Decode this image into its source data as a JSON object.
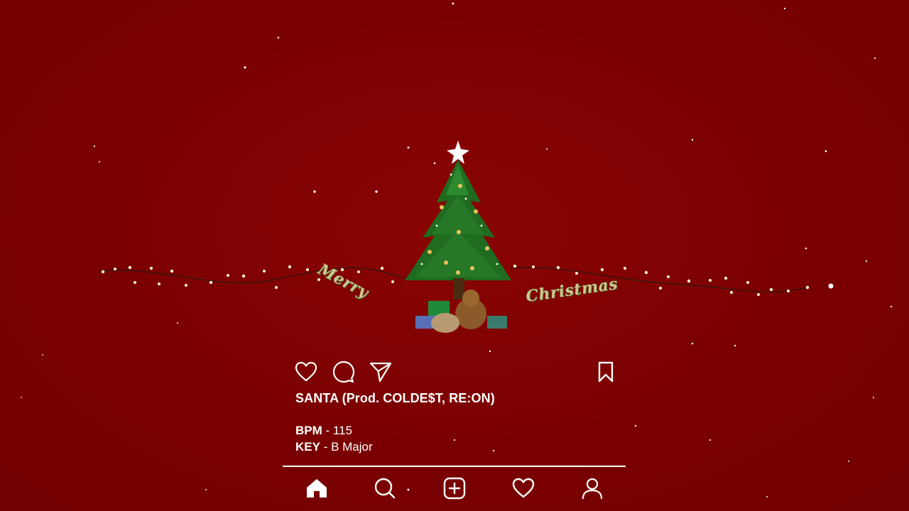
{
  "artwork": {
    "word_left": "Merry",
    "word_right": "Christmas",
    "colors": {
      "background": "#7a0000",
      "tree": "#1f6b1f",
      "star": "#ffffff",
      "text_gold": "#c9c78f"
    }
  },
  "post": {
    "actions": [
      {
        "icon": "heart-outline-icon"
      },
      {
        "icon": "comment-bubble-icon"
      },
      {
        "icon": "send-paper-plane-icon"
      },
      {
        "icon": "bookmark-icon"
      }
    ],
    "title": "SANTA (Prod. COLDE$T, RE:ON)",
    "bpm_label": "BPM",
    "bpm_value": " - 115",
    "key_label": "KEY",
    "key_value": " - B Major"
  },
  "bottom_nav": {
    "items": [
      {
        "icon": "home-icon",
        "active": true
      },
      {
        "icon": "search-icon"
      },
      {
        "icon": "add-post-icon"
      },
      {
        "icon": "activity-heart-icon"
      },
      {
        "icon": "profile-icon"
      }
    ]
  }
}
